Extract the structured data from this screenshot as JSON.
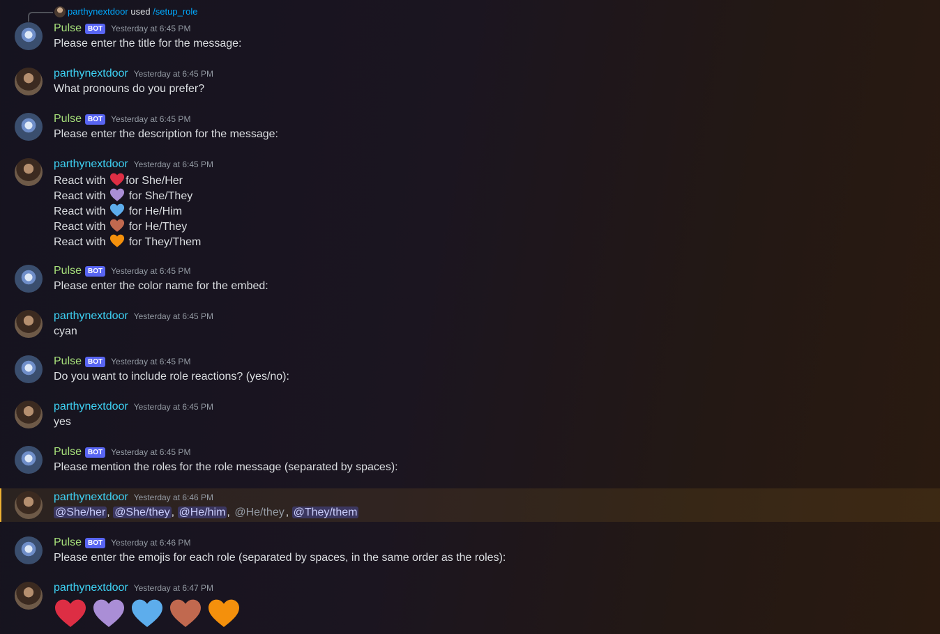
{
  "reply": {
    "user": "parthynextdoor",
    "used": "used",
    "command": "/setup_role"
  },
  "bot": {
    "name": "Pulse",
    "badge": "BOT"
  },
  "user": {
    "name": "parthynextdoor"
  },
  "colors": {
    "red": "#dd2e44",
    "purple": "#aa8ed6",
    "blue": "#5dadec",
    "brown": "#c1694f",
    "orange": "#f4900c"
  },
  "messages": [
    {
      "time": "Yesterday at 6:45 PM",
      "text": "Please enter the title for the message:"
    },
    {
      "time": "Yesterday at 6:45 PM",
      "text": "What pronouns do you prefer?"
    },
    {
      "time": "Yesterday at 6:45 PM",
      "text": "Please enter the description for the message:"
    },
    {
      "time": "Yesterday at 6:45 PM",
      "lines": [
        {
          "pre": "React with",
          "post": "for She/Her"
        },
        {
          "pre": "React with",
          "post": "for She/They"
        },
        {
          "pre": "React with",
          "post": "for He/Him"
        },
        {
          "pre": "React with",
          "post": "for He/They"
        },
        {
          "pre": "React with",
          "post": "for They/Them"
        }
      ]
    },
    {
      "time": "Yesterday at 6:45 PM",
      "text": "Please enter the color name for the embed:"
    },
    {
      "time": "Yesterday at 6:45 PM",
      "text": "cyan"
    },
    {
      "time": "Yesterday at 6:45 PM",
      "text": "Do you want to include role reactions? (yes/no):"
    },
    {
      "time": "Yesterday at 6:45 PM",
      "text": "yes"
    },
    {
      "time": "Yesterday at 6:45 PM",
      "text": "Please mention the roles for the role message (separated by spaces):"
    },
    {
      "time": "Yesterday at 6:46 PM",
      "mentions": [
        "@She/her",
        "@She/they",
        "@He/him",
        "@He/they",
        "@They/them"
      ],
      "separator": ","
    },
    {
      "time": "Yesterday at 6:46 PM",
      "text": "Please enter the emojis for each role (separated by spaces, in the same order as the roles):"
    },
    {
      "time": "Yesterday at 6:47 PM",
      "emoji_icons": [
        "red-heart",
        "purple-heart",
        "blue-heart",
        "brown-heart",
        "orange-heart"
      ]
    }
  ]
}
